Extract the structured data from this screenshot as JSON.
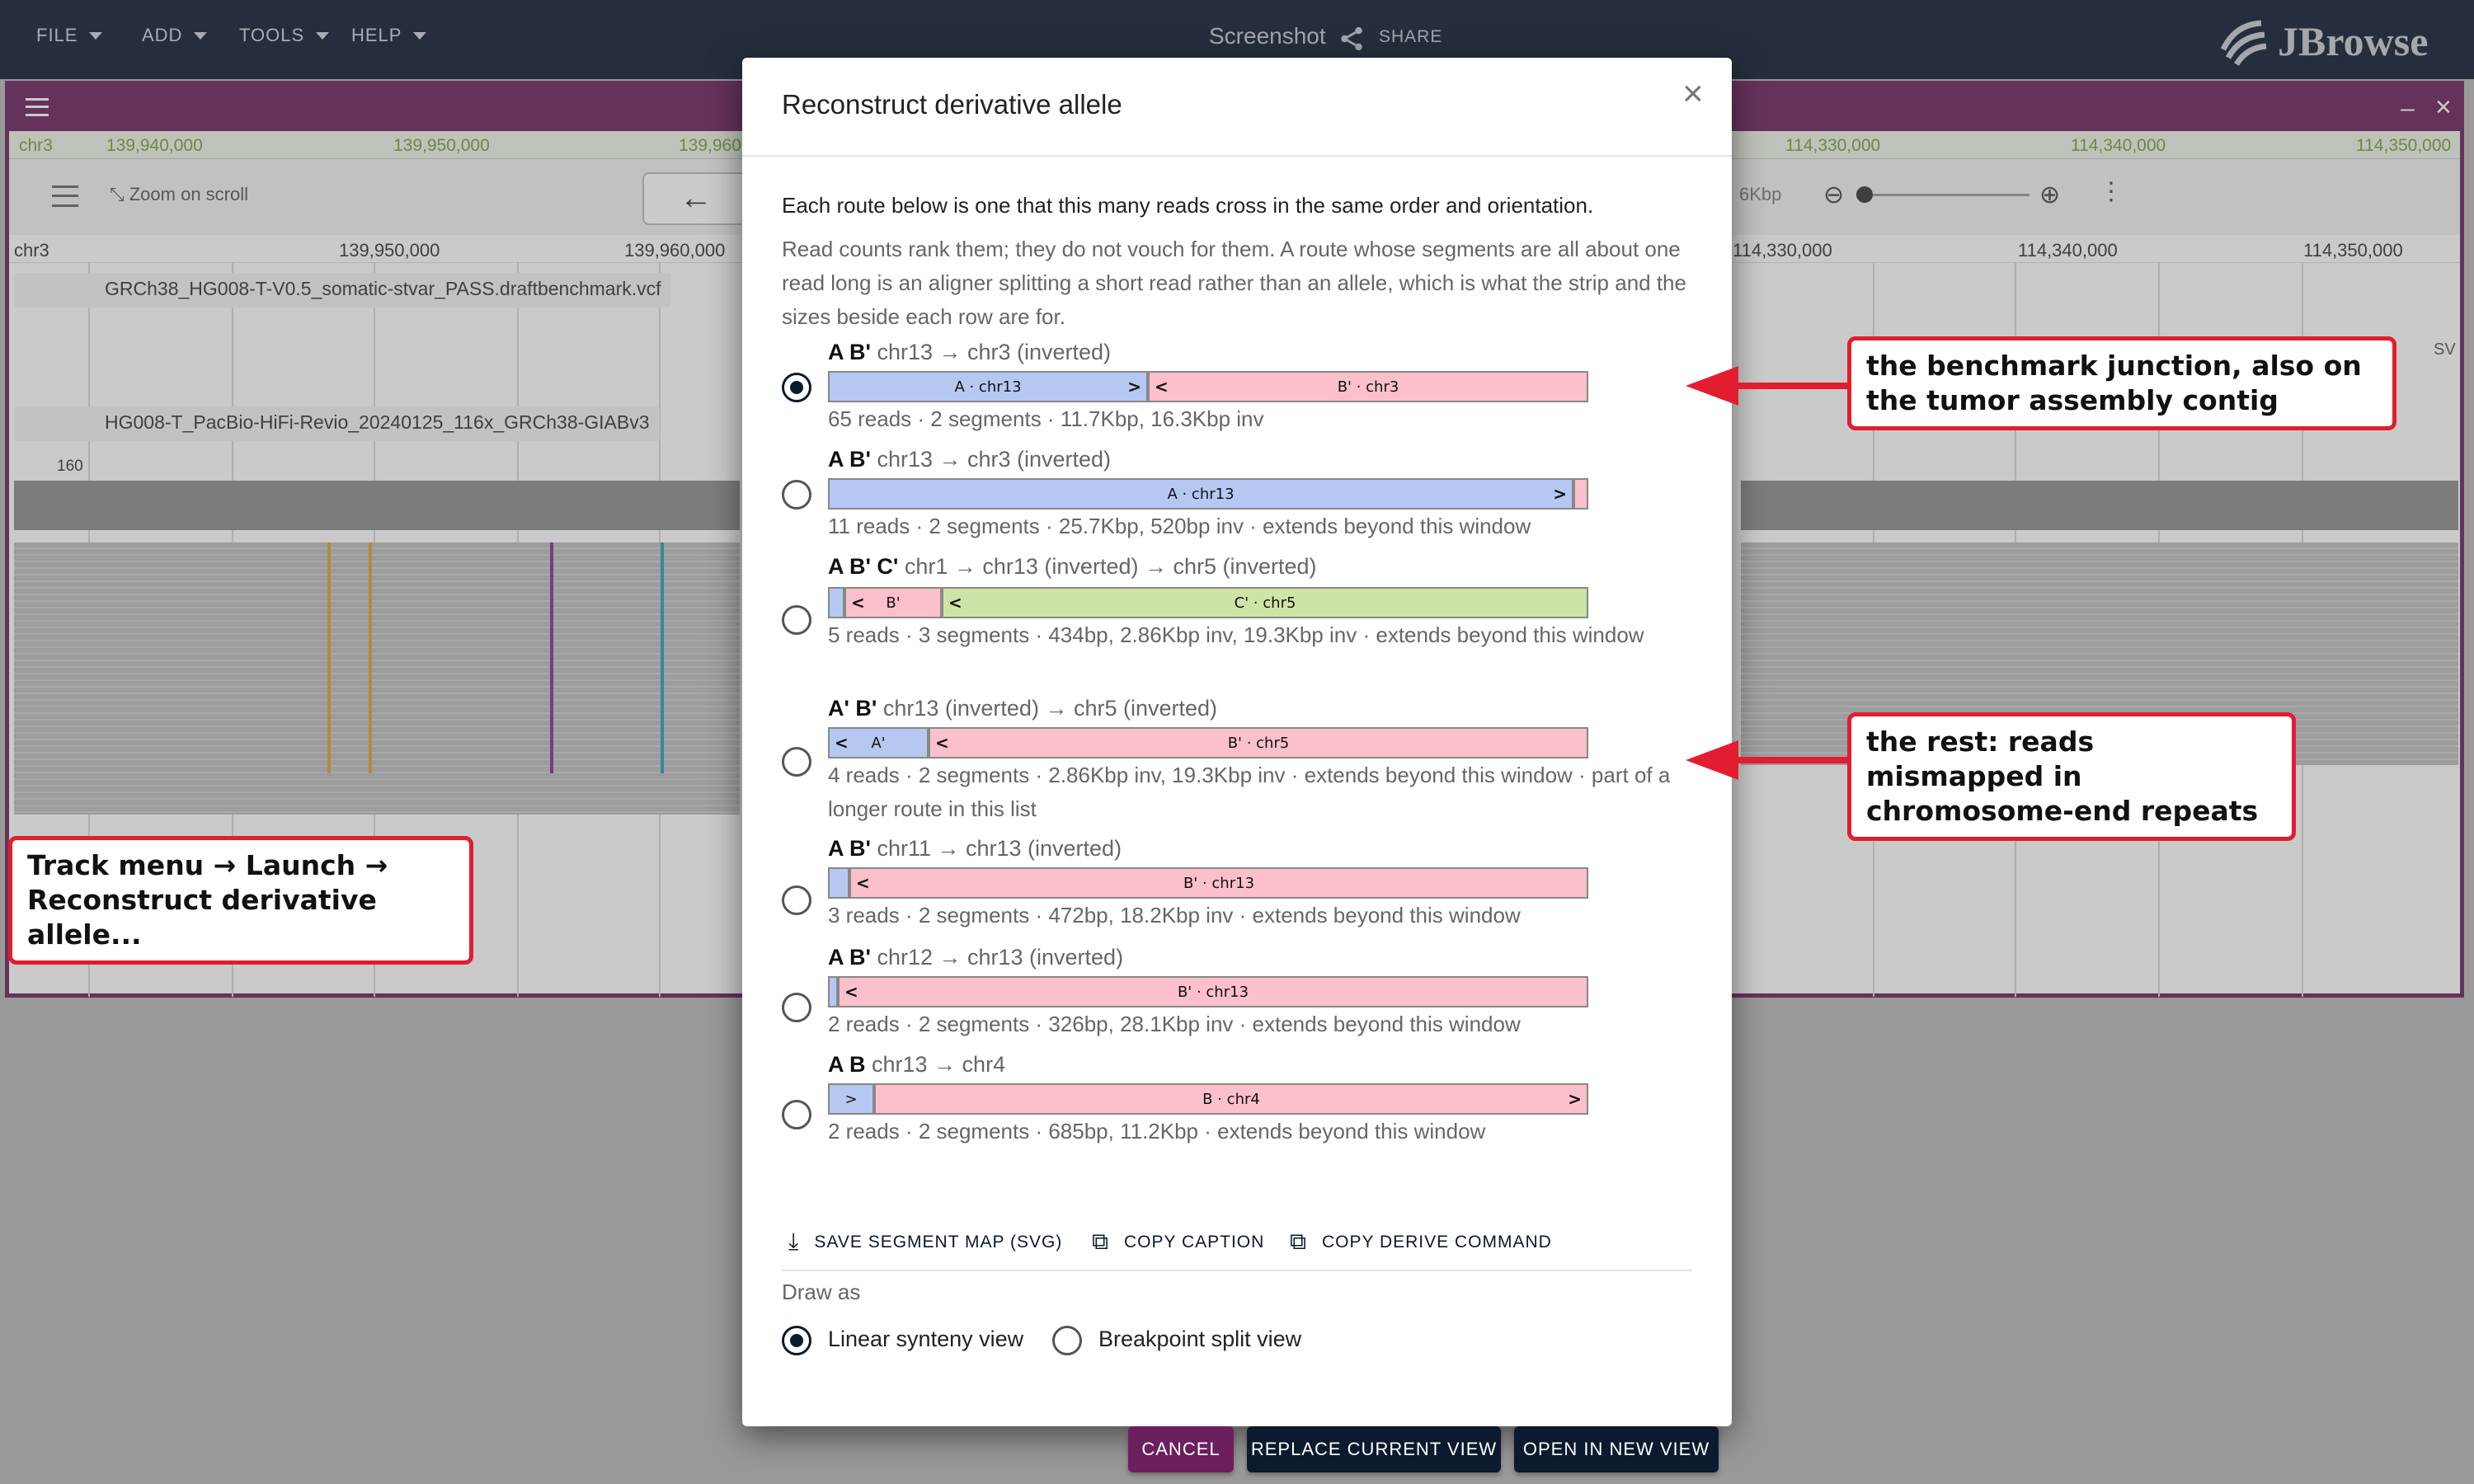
{
  "menubar": {
    "items": [
      "FILE",
      "ADD",
      "TOOLS",
      "HELP"
    ],
    "screenshot_label": "Screenshot",
    "share_label": "SHARE",
    "brand": "JBrowse"
  },
  "view": {
    "ruler_top_left": [
      "chr3",
      "139,940,000",
      "139,950,000",
      "139,960"
    ],
    "ruler_top_right": [
      "114,330,000",
      "114,340,000",
      "114,350,000"
    ],
    "zoom_on_scroll": "Zoom on scroll",
    "span_fragment": "6Kbp",
    "ruler_left": [
      "chr3",
      "139,950,000",
      "139,960,000"
    ],
    "ruler_right": [
      "114,330,000",
      "114,340,000",
      "114,350,000"
    ],
    "track1_name": "GRCh38_HG008-T-V0.5_somatic-stvar_PASS.draftbenchmark.vcf",
    "track2_name": "HG008-T_PacBio-HiFi-Revio_20240125_116x_GRCh38-GIABv3",
    "coverage_max": "160",
    "coverage_min": "0",
    "edge_label": "SV"
  },
  "dialog": {
    "title": "Reconstruct derivative allele",
    "close": "×",
    "intro": "Each route below is one that this many reads cross in the same order and orientation.",
    "note": "Read counts rank them; they do not vouch for them. A route whose segments are all about one read long is an aligner splitting a short read rather than an allele, which is what the strip and the sizes beside each row are for.",
    "routes": [
      {
        "labels": "A B'",
        "desc": "chr13 → chr3 (inverted)",
        "caption": "65 reads · 2 segments · 11.7Kbp, 16.3Kbp inv",
        "selected": true,
        "segments": [
          {
            "text": "A · chr13",
            "color": "blue",
            "arrow": ">"
          },
          {
            "text": "B' · chr3",
            "color": "pink",
            "arrow": "<"
          }
        ]
      },
      {
        "labels": "A B'",
        "desc": "chr13 → chr3 (inverted)",
        "caption": "11 reads · 2 segments · 25.7Kbp, 520bp inv · extends beyond this window",
        "selected": false,
        "segments": [
          {
            "text": "A · chr13",
            "color": "blue",
            "arrow": ">"
          },
          {
            "text": "",
            "color": "pink",
            "arrow": ""
          }
        ]
      },
      {
        "labels": "A B' C'",
        "desc": "chr1 → chr13 (inverted) → chr5 (inverted)",
        "caption": "5 reads · 3 segments · 434bp, 2.86Kbp inv, 19.3Kbp inv · extends beyond this window",
        "selected": false,
        "segments": [
          {
            "text": "",
            "color": "blue",
            "arrow": ""
          },
          {
            "text": "B'",
            "color": "pink",
            "arrow": "<"
          },
          {
            "text": "C' · chr5",
            "color": "green",
            "arrow": "<"
          }
        ]
      },
      {
        "labels": "A' B'",
        "desc": "chr13 (inverted) → chr5 (inverted)",
        "caption": "4 reads · 2 segments · 2.86Kbp inv, 19.3Kbp inv · extends beyond this window · part of a longer route in this list",
        "selected": false,
        "segments": [
          {
            "text": "A'",
            "color": "blue",
            "arrow": "<"
          },
          {
            "text": "B' · chr5",
            "color": "pink",
            "arrow": "<"
          }
        ]
      },
      {
        "labels": "A B'",
        "desc": "chr11 → chr13 (inverted)",
        "caption": "3 reads · 2 segments · 472bp, 18.2Kbp inv · extends beyond this window",
        "selected": false,
        "segments": [
          {
            "text": "",
            "color": "blue",
            "arrow": ""
          },
          {
            "text": "B' · chr13",
            "color": "pink",
            "arrow": "<"
          }
        ]
      },
      {
        "labels": "A B'",
        "desc": "chr12 → chr13 (inverted)",
        "caption": "2 reads · 2 segments · 326bp, 28.1Kbp inv · extends beyond this window",
        "selected": false,
        "segments": [
          {
            "text": "",
            "color": "blue",
            "arrow": ""
          },
          {
            "text": "B' · chr13",
            "color": "pink",
            "arrow": "<"
          }
        ]
      },
      {
        "labels": "A B",
        "desc": "chr13 → chr4",
        "caption": "2 reads · 2 segments · 685bp, 11.2Kbp · extends beyond this window",
        "selected": false,
        "segments": [
          {
            "text": "",
            "color": "blue",
            "arrow": ">"
          },
          {
            "text": "B · chr4",
            "color": "pink",
            "arrow": ">"
          }
        ]
      }
    ],
    "actions": {
      "save_svg": "SAVE SEGMENT MAP (SVG)",
      "copy_caption": "COPY CAPTION",
      "copy_command": "COPY DERIVE COMMAND"
    },
    "draw_as": "Draw as",
    "draw_options": [
      "Linear synteny view",
      "Breakpoint split view"
    ],
    "buttons": {
      "cancel": "CANCEL",
      "replace": "REPLACE CURRENT VIEW",
      "open_new": "OPEN IN NEW VIEW"
    }
  },
  "annotations": {
    "benchmark": "the benchmark junction, also on the tumor assembly contig",
    "rest": "the rest: reads mismapped in chromosome-end repeats",
    "track_menu": "Track menu → Launch → Reconstruct derivative allele..."
  },
  "colors": {
    "navy": "#0b1a2e",
    "purple": "#6b1f5e",
    "segment_blue": "#b5c8f2",
    "segment_pink": "#fbc0cb",
    "segment_green": "#cde4a7",
    "callout_red": "#e21d2f"
  }
}
